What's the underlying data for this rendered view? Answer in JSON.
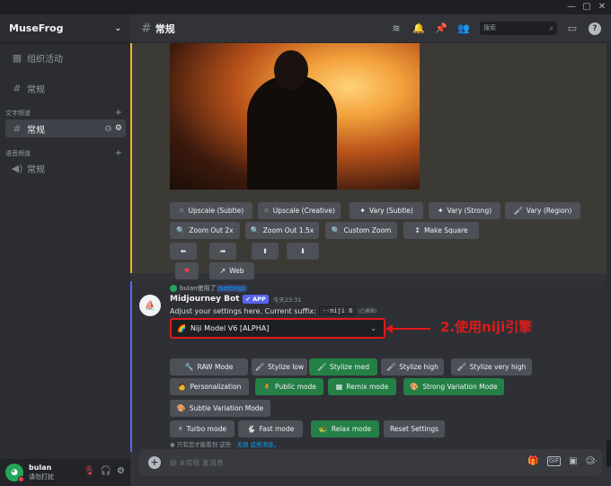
{
  "window": {
    "controls": [
      "—",
      "▢",
      "✕"
    ]
  },
  "sidebar": {
    "guild_name": "MuseFrog",
    "events": "组织活动",
    "channel_top": "常规",
    "cat_text": "文字频道",
    "text_channel": "常规",
    "cat_voice": "语音频道",
    "voice_channel": "常规"
  },
  "user": {
    "name": "bulan",
    "status": "请勿打扰"
  },
  "topbar": {
    "channel": "常规",
    "search_placeholder": "搜索"
  },
  "msg1": {
    "buttons": [
      {
        "label": "Upscale (Subtle)",
        "icon": "⁘"
      },
      {
        "label": "Upscale (Creative)",
        "icon": "⁘"
      },
      {
        "label": "Vary (Subtle)",
        "icon": "✦"
      },
      {
        "label": "Vary (Strong)",
        "icon": "✦"
      },
      {
        "label": "Vary (Region)",
        "icon": "🖌"
      },
      {
        "label": "Zoom Out 2x",
        "icon": "🔍"
      },
      {
        "label": "Zoom Out 1.5x",
        "icon": "🔍"
      },
      {
        "label": "Custom Zoom",
        "icon": "🔍"
      },
      {
        "label": "Make Square",
        "icon": "↕"
      },
      {
        "label": "⬅"
      },
      {
        "label": "➡"
      },
      {
        "label": "⬆"
      },
      {
        "label": "⬇"
      },
      {
        "label": "♥"
      },
      {
        "label": "Web",
        "icon": "↗"
      }
    ]
  },
  "msg2": {
    "reply_user": "bulan使用了",
    "reply_cmd": "/settings",
    "bot_name": "Midjourney Bot",
    "bot_badge": "✔ APP",
    "timestamp": "今天23:31",
    "settings_text": "Adjust your settings here. Current suffix:",
    "suffix": "--niji 6",
    "edited": "(已编辑)",
    "model_select": "Niji Model V6 [ALPHA]",
    "annotation": "2.使用niji引擎",
    "buttons": [
      {
        "label": "RAW Mode",
        "icon": "🔧"
      },
      {
        "label": "Stylize low",
        "icon": "🖌"
      },
      {
        "label": "Stylize med",
        "icon": "🖌"
      },
      {
        "label": "Stylize high",
        "icon": "🖌"
      },
      {
        "label": "Stylize very high",
        "icon": "🖌"
      },
      {
        "label": "Personalization",
        "icon": "🧑"
      },
      {
        "label": "Public mode",
        "icon": "🧍"
      },
      {
        "label": "Remix mode",
        "icon": "▦"
      },
      {
        "label": "Strong Variation Mode",
        "icon": "🎨"
      },
      {
        "label": "Subtle Variation Mode",
        "icon": "🎨"
      },
      {
        "label": "Turbo mode",
        "icon": "⚡"
      },
      {
        "label": "Fast mode",
        "icon": "🐇"
      },
      {
        "label": "Relax mode",
        "icon": "🐢"
      },
      {
        "label": "Reset Settings"
      }
    ],
    "ephemeral": "只有您才能看到 这些 · ",
    "ephemeral_link": "无视 这些消息。"
  },
  "input": {
    "placeholder": "给 #常规 发消息"
  }
}
